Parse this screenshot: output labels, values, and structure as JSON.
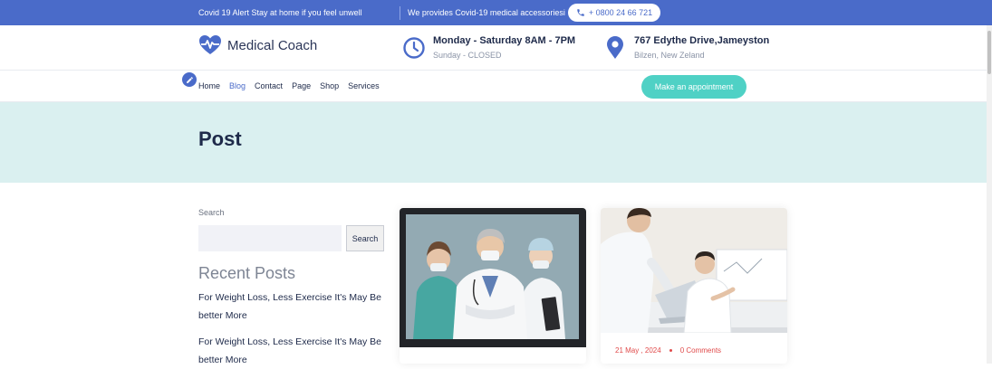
{
  "topbar": {
    "alert": "Covid 19 Alert Stay at home if you feel unwell",
    "provides": "We provides Covid-19 medical accessoriesi",
    "phone": "+ 0800 24 66 721"
  },
  "header": {
    "logo_text": "Medical Coach",
    "hours_title": "Monday - Saturday 8AM - 7PM",
    "hours_sub": "Sunday - CLOSED",
    "address_title": "767 Edythe Drive,Jameyston",
    "address_sub": "Bilzen, New Zeland"
  },
  "nav": {
    "items": [
      {
        "label": "Home"
      },
      {
        "label": "Blog"
      },
      {
        "label": "Contact"
      },
      {
        "label": "Page"
      },
      {
        "label": "Shop"
      },
      {
        "label": "Services"
      }
    ],
    "appointment": "Make an appointment"
  },
  "banner": {
    "title": "Post"
  },
  "sidebar": {
    "search_label": "Search",
    "search_placeholder": "",
    "search_button": "Search",
    "recent_title": "Recent Posts",
    "posts": [
      "For Weight Loss, Less Exercise It's May Be better More",
      "For Weight Loss, Less Exercise It's May Be better More"
    ]
  },
  "cards": [
    {
      "date": "",
      "comments": ""
    },
    {
      "date": "21  May , 2024",
      "comments": "0 Comments"
    }
  ],
  "colors": {
    "topbar": "#4a6bc9",
    "accent": "#4fd1c5",
    "banner": "#daf0f0",
    "meta": "#e04a4a"
  }
}
